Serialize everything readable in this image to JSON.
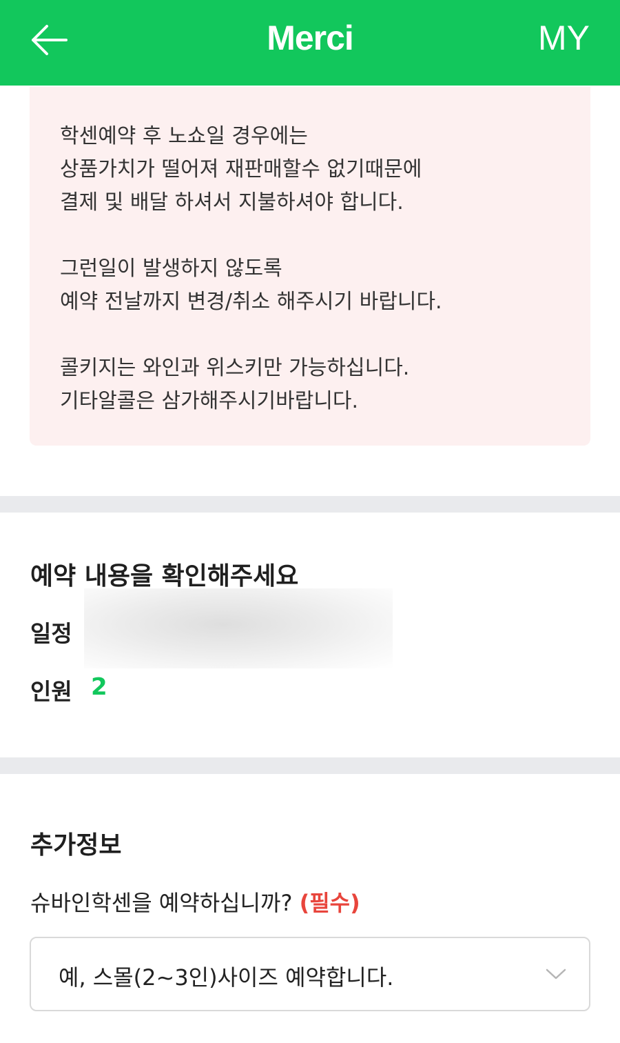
{
  "header": {
    "title": "Merci",
    "my_label": "MY",
    "back_icon": "arrow-left-icon",
    "background_color": "#12c75c"
  },
  "notice": {
    "paragraphs": [
      {
        "lines": [
          "학센예약 후 노쇼일 경우에는",
          "상품가치가 떨어져 재판매할수 없기때문에",
          "결제 및 배달 하셔서 지불하셔야 합니다."
        ]
      },
      {
        "lines": [
          "그런일이 발생하지 않도록",
          "예약 전날까지 변경/취소 해주시기 바랍니다."
        ]
      },
      {
        "lines": [
          "콜키지는 와인과 위스키만 가능하십니다.",
          "기타알콜은 삼가해주시기바랍니다."
        ]
      }
    ],
    "background_color": "#fdf0f0"
  },
  "reservation": {
    "title": "예약 내용을 확인해주세요",
    "schedule_label": "일정",
    "people_label": "인원",
    "people_value": "2"
  },
  "additional": {
    "title": "추가정보",
    "question": "슈바인학센을 예약하십니까?",
    "required_label": "(필수)",
    "selected_option": "예, 스몰(2~3인)사이즈 예약합니다.",
    "dropdown_icon": "chevron-down-icon",
    "accent_color": "#12c75c",
    "required_color": "#e8453c"
  }
}
